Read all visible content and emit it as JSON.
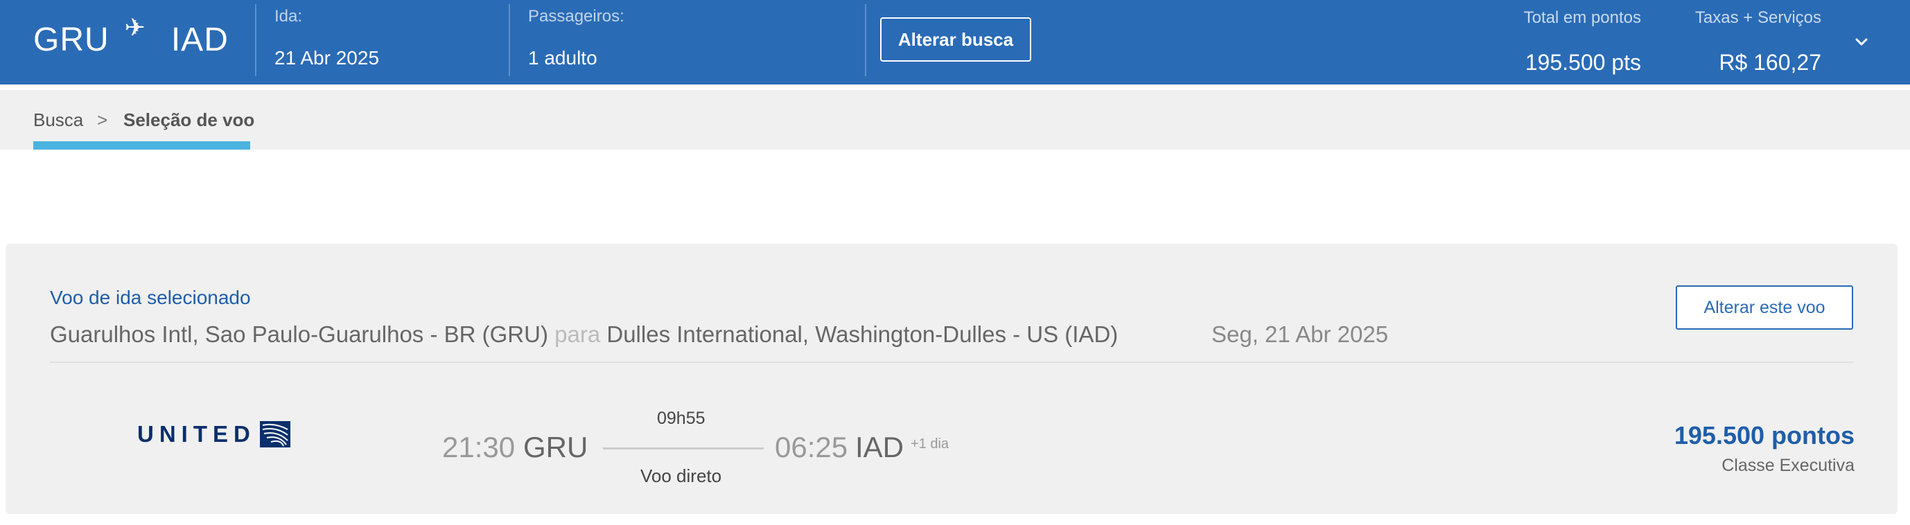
{
  "header": {
    "origin": "GRU",
    "destination": "IAD",
    "plane_icon": "airplane-icon",
    "departure_label": "Ida:",
    "departure_value": "21 Abr 2025",
    "passengers_label": "Passageiros:",
    "passengers_value": "1 adulto",
    "change_search_label": "Alterar busca",
    "total_points_label": "Total em pontos",
    "total_points_value": "195.500 pts",
    "fees_label": "Taxas + Serviços",
    "fees_value": "R$ 160,27",
    "expand_icon": "chevron-down-icon"
  },
  "breadcrumb": {
    "items": [
      "Busca",
      "Seleção de voo"
    ],
    "separator": ">"
  },
  "selected_flight": {
    "title": "Voo de ida selecionado",
    "origin_full": "Guarulhos Intl, Sao Paulo-Guarulhos - BR (GRU)",
    "connector": "para",
    "destination_full": "Dulles International, Washington-Dulles - US (IAD)",
    "date": "Seg, 21 Abr 2025",
    "change_flight_label": "Alterar este voo",
    "airline": "UNITED",
    "departure_time": "21:30",
    "departure_code": "GRU",
    "duration": "09h55",
    "stops": "Voo direto",
    "arrival_time": "06:25",
    "arrival_code": "IAD",
    "day_offset": "+1 dia",
    "price": "195.500 pontos",
    "cabin": "Classe Executiva"
  },
  "colors": {
    "header_bg": "#2a6bb6",
    "accent_blue": "#1f5ea8",
    "breadcrumb_underline": "#4bb3e0",
    "card_bg": "#f0f0f0"
  }
}
